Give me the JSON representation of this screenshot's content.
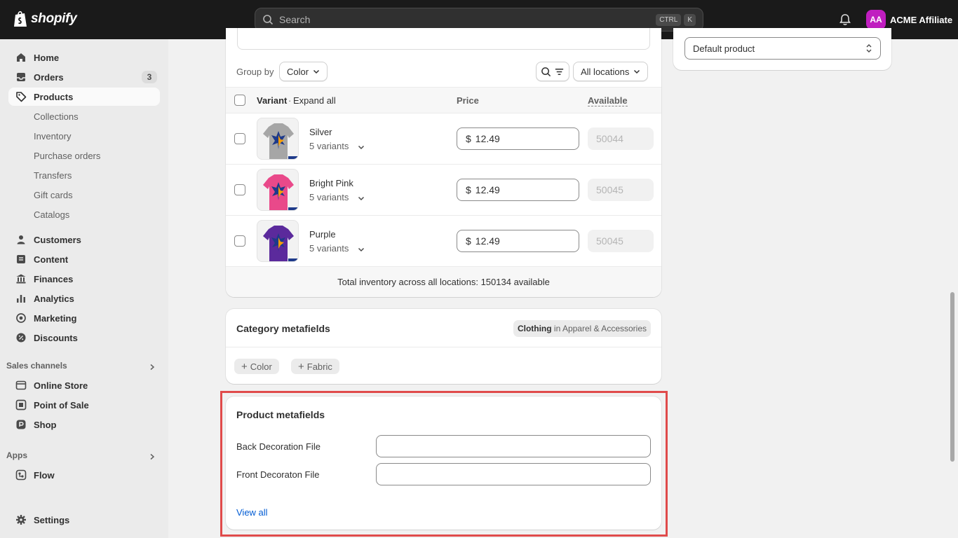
{
  "topbar": {
    "brand": "shopify",
    "search_placeholder": "Search",
    "shortcut_ctrl": "CTRL",
    "shortcut_key": "K",
    "account_initials": "AA",
    "account_name": "ACME Affiliate",
    "avatar_color": "#c01ec0"
  },
  "sidebar": {
    "home": "Home",
    "orders": "Orders",
    "orders_badge": "3",
    "products": "Products",
    "product_subitems": [
      "Collections",
      "Inventory",
      "Purchase orders",
      "Transfers",
      "Gift cards",
      "Catalogs"
    ],
    "customers": "Customers",
    "content": "Content",
    "finances": "Finances",
    "analytics": "Analytics",
    "marketing": "Marketing",
    "discounts": "Discounts",
    "sales_channels_label": "Sales channels",
    "online_store": "Online Store",
    "point_of_sale": "Point of Sale",
    "shop": "Shop",
    "apps_label": "Apps",
    "flow": "Flow",
    "settings": "Settings"
  },
  "variants_card": {
    "group_by_label": "Group by",
    "group_by_value": "Color",
    "locations_value": "All locations",
    "col_variant": "Variant",
    "expand_all": "Expand all",
    "col_price": "Price",
    "col_available": "Available",
    "rows": [
      {
        "name": "Silver",
        "variants": "5 variants",
        "currency": "$",
        "price": "12.49",
        "available": "50044",
        "shirt_color": "#a6a6a6"
      },
      {
        "name": "Bright Pink",
        "variants": "5 variants",
        "currency": "$",
        "price": "12.49",
        "available": "50045",
        "shirt_color": "#e9498a"
      },
      {
        "name": "Purple",
        "variants": "5 variants",
        "currency": "$",
        "price": "12.49",
        "available": "50045",
        "shirt_color": "#5b2a9c"
      }
    ],
    "total_inventory": "Total inventory across all locations: 150134 available"
  },
  "category_card": {
    "title": "Category metafields",
    "category_strong": "Clothing",
    "category_rest": " in Apparel & Accessories",
    "pills": [
      "Color",
      "Fabric"
    ]
  },
  "product_metafields": {
    "title": "Product metafields",
    "field1_label": "Back Decoration File",
    "field1_value": "",
    "field2_label": "Front Decoraton File",
    "field2_value": "",
    "view_all": "View all",
    "link_color": "#005bd3"
  },
  "right_card": {
    "select_value": "Default product"
  }
}
